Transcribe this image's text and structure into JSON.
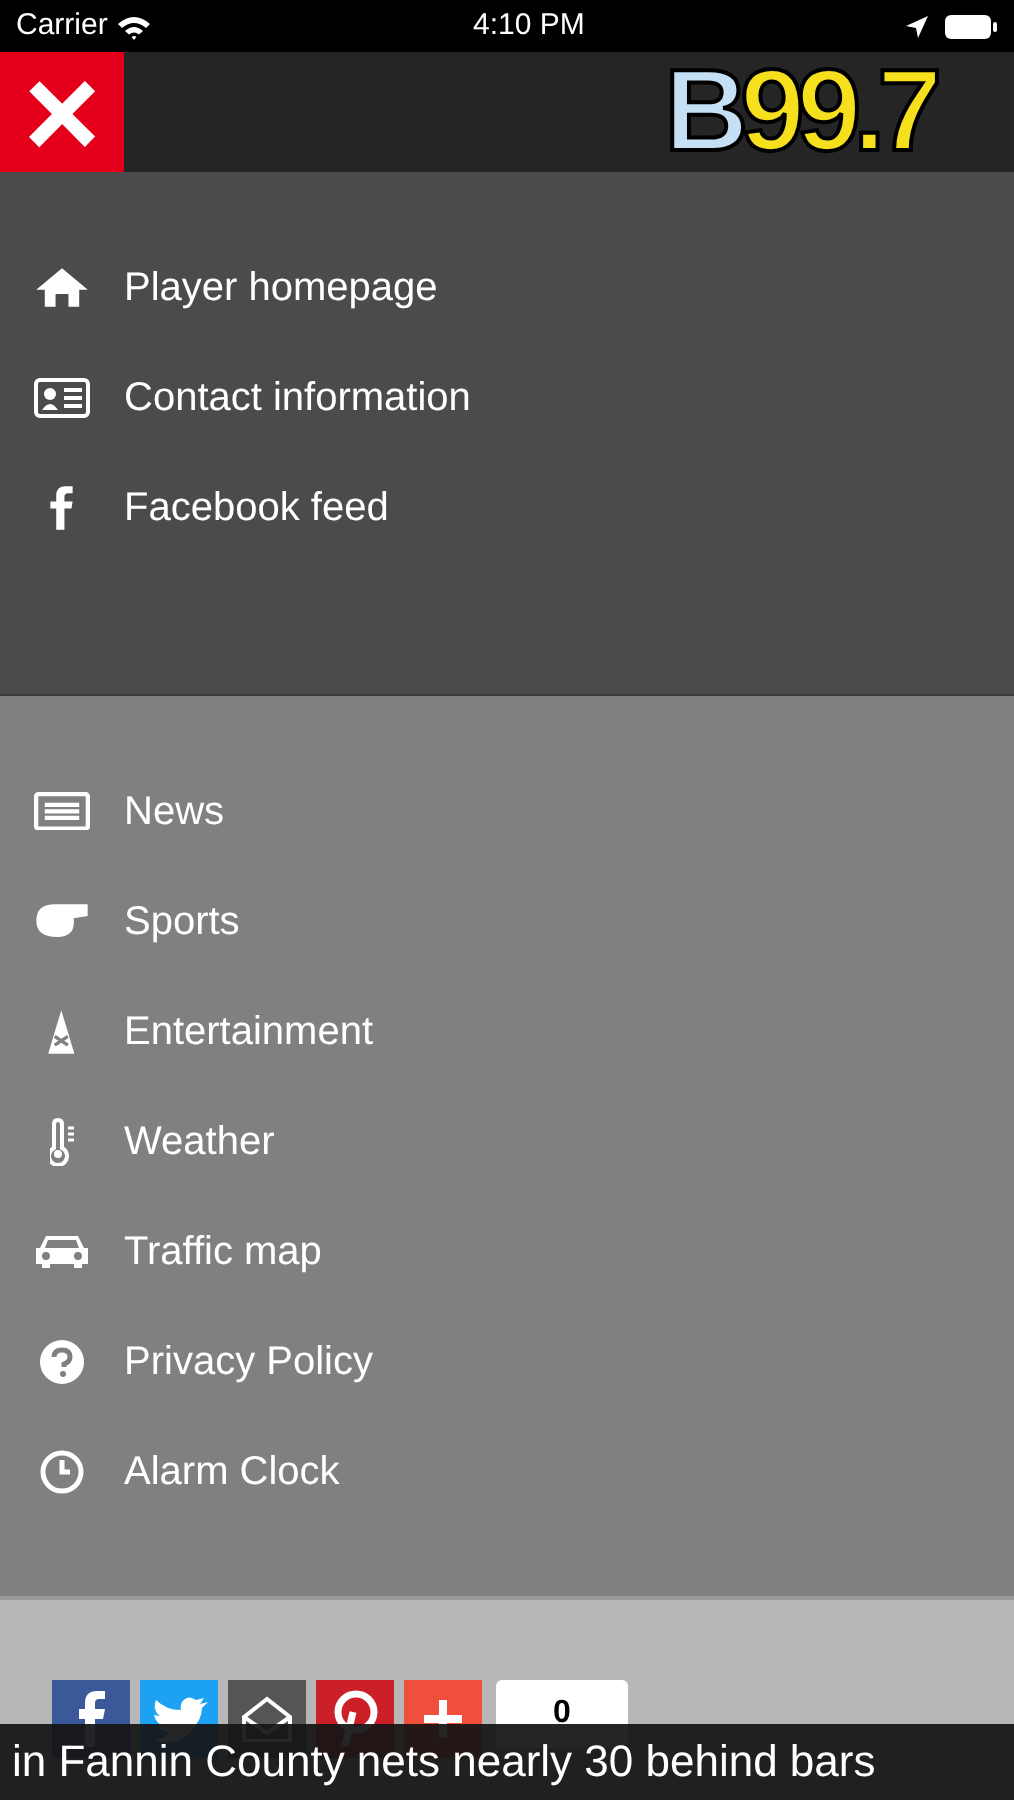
{
  "status_bar": {
    "carrier": "Carrier",
    "time": "4:10 PM"
  },
  "header": {
    "close_label": "×",
    "logo": {
      "prefix": "B",
      "number": "99.7"
    }
  },
  "sections": [
    {
      "kind": "dark",
      "items": [
        {
          "label": "Player homepage"
        },
        {
          "label": "Contact information"
        },
        {
          "label": "Facebook feed"
        }
      ]
    },
    {
      "kind": "light",
      "items": [
        {
          "label": "News"
        },
        {
          "label": "Sports"
        },
        {
          "label": "Entertainment"
        },
        {
          "label": "Weather"
        },
        {
          "label": "Traffic map"
        },
        {
          "label": "Privacy Policy"
        },
        {
          "label": "Alarm Clock"
        }
      ]
    }
  ],
  "share": {
    "buttons": [
      {
        "kind": "facebook",
        "color": "#3b5998"
      },
      {
        "kind": "twitter",
        "color": "#1da1f2"
      },
      {
        "kind": "email",
        "color": "#555555"
      },
      {
        "kind": "pinterest",
        "color": "#cb2027"
      },
      {
        "kind": "plus",
        "color": "#f04f3b"
      }
    ],
    "count": "0"
  },
  "ticker": "in Fannin County nets nearly 30 behind bars"
}
